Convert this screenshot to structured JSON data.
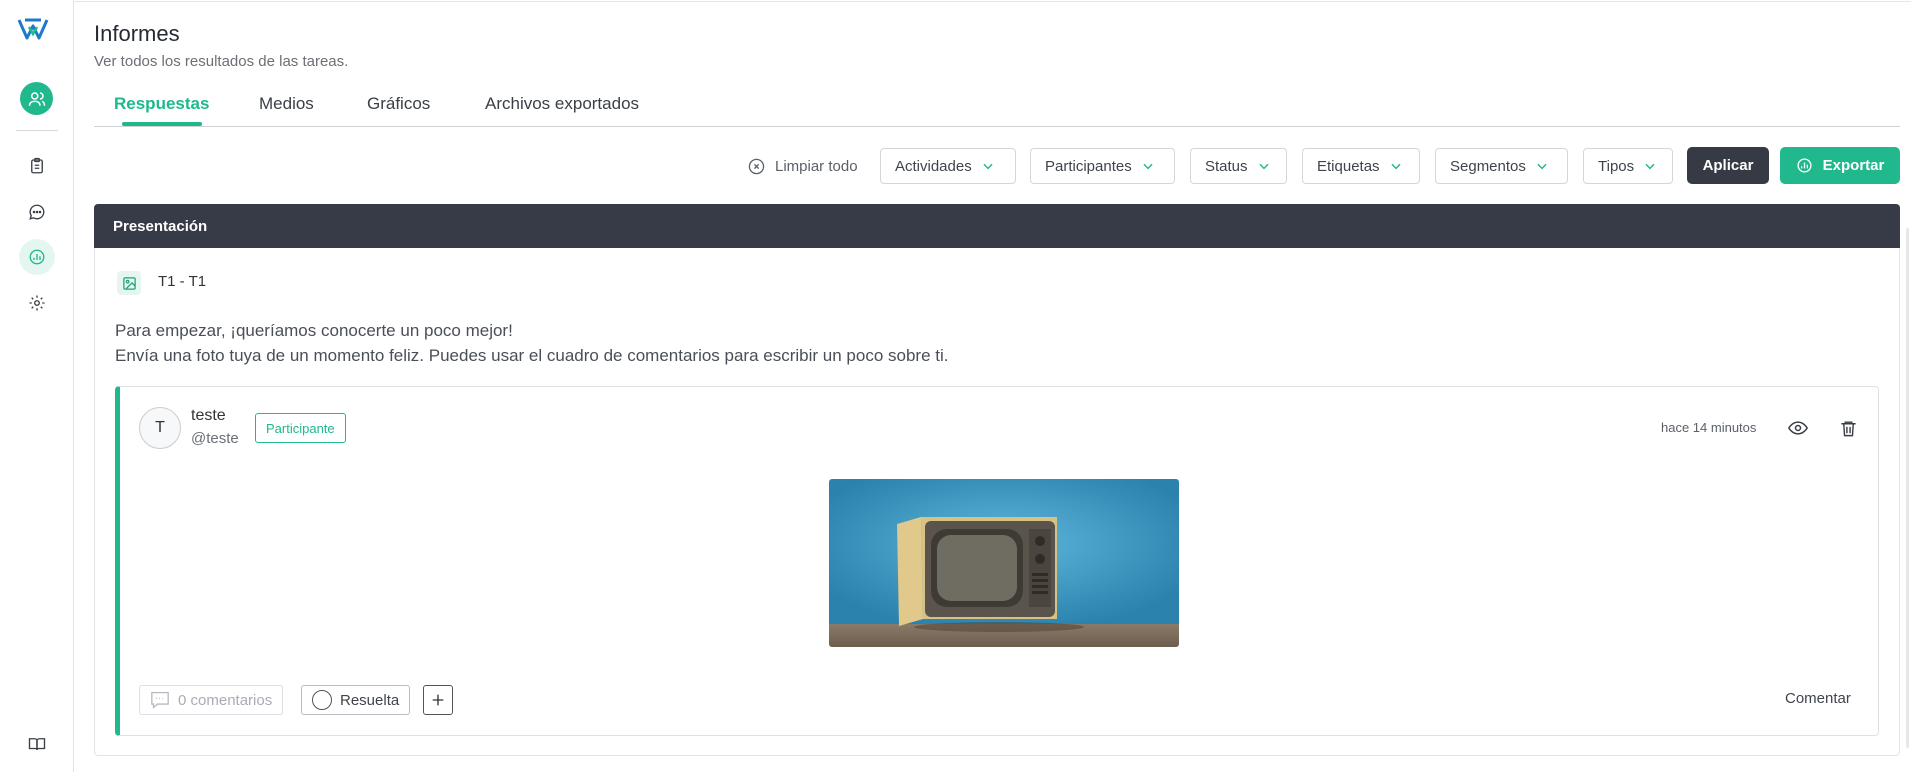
{
  "header": {
    "title": "Informes",
    "subtitle": "Ver todos los resultados de las tareas."
  },
  "tabs": [
    {
      "label": "Respuestas",
      "active": true
    },
    {
      "label": "Medios",
      "active": false
    },
    {
      "label": "Gráficos",
      "active": false
    },
    {
      "label": "Archivos exportados",
      "active": false
    }
  ],
  "filters": {
    "clear_all": "Limpiar todo",
    "items": [
      "Actividades",
      "Participantes",
      "Status",
      "Etiquetas",
      "Segmentos",
      "Tipos"
    ],
    "apply": "Aplicar",
    "export": "Exportar"
  },
  "section": {
    "title": "Presentación",
    "task_label": "T1 - T1",
    "prompt_line1": "Para empezar, ¡queríamos conocerte un poco mejor!",
    "prompt_line2": "Envía una foto tuya de un momento feliz. Puedes usar el cuadro de comentarios para escribir un poco sobre ti."
  },
  "response": {
    "avatar_initial": "T",
    "name": "teste",
    "handle": "@teste",
    "role": "Participante",
    "timestamp": "hace 14 minutos",
    "comments": "0 comentarios",
    "resolved": "Resuelta",
    "comment_action": "Comentar"
  },
  "colors": {
    "accent": "#21b88e",
    "dark": "#363b47"
  },
  "icons": {
    "sidebar": [
      "user-icon",
      "clipboard-icon",
      "chat-icon",
      "chart-icon",
      "gear-icon",
      "book-icon"
    ],
    "actions": [
      "eye-icon",
      "trash-icon"
    ]
  }
}
